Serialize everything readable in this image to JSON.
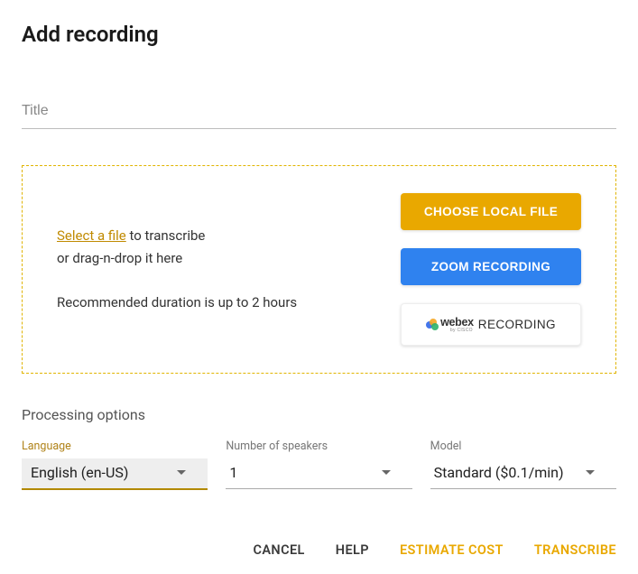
{
  "page_title": "Add recording",
  "title_input": {
    "placeholder": "Title",
    "value": ""
  },
  "dropzone": {
    "select_text": "Select a file",
    "transcribe_suffix": " to transcribe",
    "drag_text": "or drag-n-drop it here",
    "recommendation": "Recommended duration is up to 2 hours",
    "buttons": {
      "local": "CHOOSE LOCAL FILE",
      "zoom": "ZOOM RECORDING",
      "webex_brand": "webex",
      "webex_sub": "by CISCO",
      "webex_label": " RECORDING"
    }
  },
  "processing": {
    "heading": "Processing options",
    "language": {
      "label": "Language",
      "value": "English (en-US)"
    },
    "speakers": {
      "label": "Number of speakers",
      "value": "1"
    },
    "model": {
      "label": "Model",
      "value": "Standard ($0.1/min)"
    }
  },
  "footer": {
    "cancel": "CANCEL",
    "help": "HELP",
    "estimate": "ESTIMATE COST",
    "transcribe": "TRANSCRIBE"
  }
}
